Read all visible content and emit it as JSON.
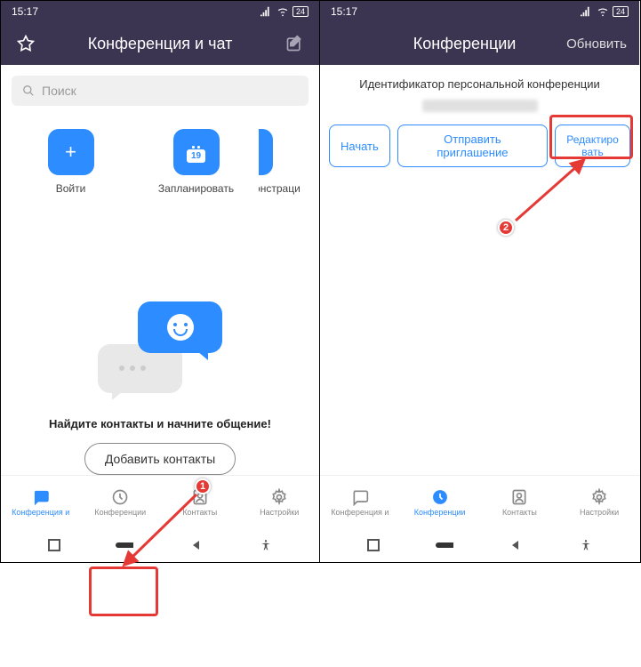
{
  "status": {
    "time": "15:17",
    "battery": "24"
  },
  "left": {
    "header": {
      "title": "Конференция и чат"
    },
    "search_placeholder": "Поиск",
    "actions": {
      "join": {
        "label": "Войти",
        "icon": "plus"
      },
      "schedule": {
        "label": "Запланировать",
        "icon_day": "19"
      },
      "demo": {
        "label": "Демонстраци",
        "icon": "upload"
      }
    },
    "empty": {
      "text": "Найдите контакты и начните общение!",
      "button": "Добавить контакты"
    },
    "nav": [
      {
        "label": "Конференция и",
        "active": true,
        "icon": "chat"
      },
      {
        "label": "Конференции",
        "active": false,
        "icon": "clock"
      },
      {
        "label": "Контакты",
        "active": false,
        "icon": "contact"
      },
      {
        "label": "Настройки",
        "active": false,
        "icon": "gear"
      }
    ]
  },
  "right": {
    "header": {
      "title": "Конференции",
      "action": "Обновить"
    },
    "subtitle": "Идентификатор персональной конференции",
    "buttons": {
      "start": "Начать",
      "invite": "Отправить приглашение",
      "edit": "Редактиро\nвать"
    },
    "nav": [
      {
        "label": "Конференция и",
        "active": false,
        "icon": "chat"
      },
      {
        "label": "Конференции",
        "active": true,
        "icon": "clock"
      },
      {
        "label": "Контакты",
        "active": false,
        "icon": "contact"
      },
      {
        "label": "Настройки",
        "active": false,
        "icon": "gear"
      }
    ]
  },
  "annotations": {
    "marker1": "1",
    "marker2": "2"
  }
}
